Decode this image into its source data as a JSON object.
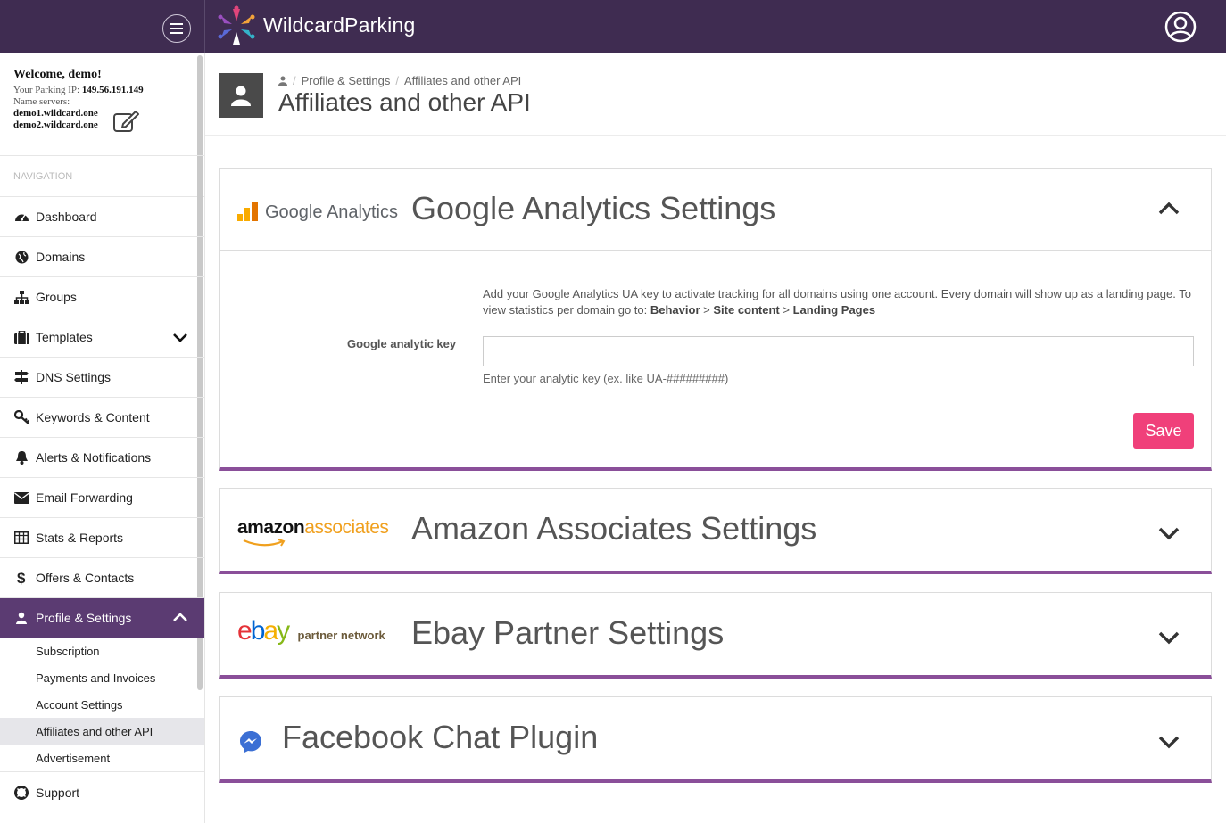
{
  "app": {
    "brand": "WildcardParking",
    "colors": {
      "topbar": "#3f2c51",
      "active_nav": "#5b3b72",
      "accent_line": "#8a4f99",
      "save_button": "#f0407a"
    }
  },
  "topbar": {
    "menu_icon": "hamburger-icon",
    "user_icon": "user-circle-icon"
  },
  "sidebar": {
    "welcome": "Welcome, demo!",
    "ip_label": "Your Parking IP:",
    "ip_value": "149.56.191.149",
    "ns_label": "Name servers:",
    "ns1": "demo1.wildcard.one",
    "ns2": "demo2.wildcard.one",
    "nav_header": "NAVIGATION",
    "items": [
      {
        "label": "Dashboard",
        "icon": "dashboard-icon"
      },
      {
        "label": "Domains",
        "icon": "globe-icon"
      },
      {
        "label": "Groups",
        "icon": "sitemap-icon"
      },
      {
        "label": "Templates",
        "icon": "briefcase-icon"
      },
      {
        "label": "DNS Settings",
        "icon": "signpost-icon"
      },
      {
        "label": "Keywords & Content",
        "icon": "key-icon"
      },
      {
        "label": "Alerts & Notifications",
        "icon": "bell-icon"
      },
      {
        "label": "Email Forwarding",
        "icon": "envelope-icon"
      },
      {
        "label": "Stats & Reports",
        "icon": "table-icon"
      },
      {
        "label": "Offers & Contacts",
        "icon": "dollar-icon"
      },
      {
        "label": "Profile & Settings",
        "icon": "user-icon"
      },
      {
        "label": "Support",
        "icon": "lifebuoy-icon"
      }
    ],
    "sub_items": [
      {
        "label": "Subscription"
      },
      {
        "label": "Payments and Invoices"
      },
      {
        "label": "Account Settings"
      },
      {
        "label": "Affiliates and other API"
      },
      {
        "label": "Advertisement"
      }
    ]
  },
  "page": {
    "breadcrumb": [
      "Profile & Settings",
      "Affiliates and other API"
    ],
    "title": "Affiliates and other API"
  },
  "panels": {
    "google": {
      "logo_text": "Google Analytics",
      "title": "Google Analytics Settings",
      "desc_text": "Add your Google Analytics UA key to activate tracking for all domains using one account. Every domain will show up as a landing page. To view statistics per domain go to:",
      "path_1": "Behavior",
      "path_2": "Site content",
      "path_3": "Landing Pages",
      "path_sep": ">",
      "field_label": "Google analytic key",
      "field_value": "",
      "help": "Enter your analytic key (ex. like UA-#########)",
      "save_label": "Save"
    },
    "amazon": {
      "logo_text_1": "amazon",
      "logo_text_2": "associates",
      "title": "Amazon Associates Settings"
    },
    "ebay": {
      "logo_e": "e",
      "logo_b": "b",
      "logo_a": "a",
      "logo_y": "y",
      "logo_sub": "partner network",
      "title": "Ebay Partner Settings"
    },
    "facebook": {
      "title": "Facebook Chat Plugin"
    }
  }
}
